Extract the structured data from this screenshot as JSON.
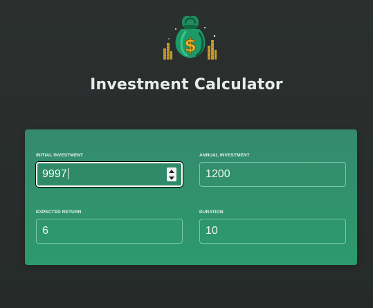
{
  "app": {
    "title": "Investment Calculator",
    "logo_icon": "money-bag-dollar-icon"
  },
  "colors": {
    "page_background": "#282d2c",
    "card_top": "#358a6e",
    "card_bottom": "#2c9a6c",
    "field_border": "#7fc7a7",
    "title_text": "#e6ecea"
  },
  "form": {
    "initial_investment": {
      "label": "INITIAL INVESTMENT",
      "value": "9997"
    },
    "annual_investment": {
      "label": "ANNUAL INVESTMENT",
      "value": "1200"
    },
    "expected_return": {
      "label": "EXPECTED RETURN",
      "value": "6"
    },
    "duration": {
      "label": "DURATION",
      "value": "10"
    }
  }
}
